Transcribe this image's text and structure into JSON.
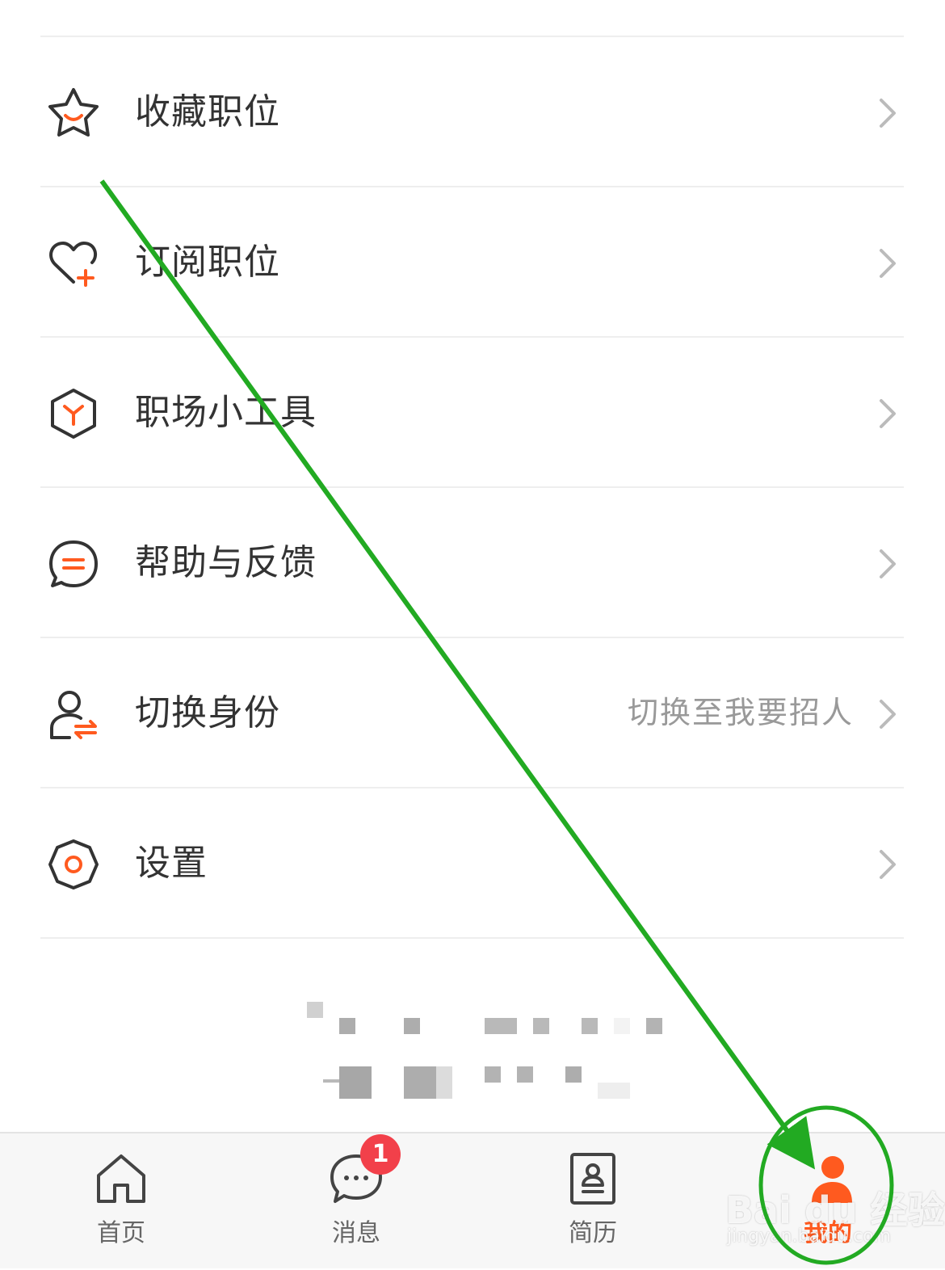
{
  "menu": {
    "items": [
      {
        "label": "收藏职位",
        "icon": "star-smile-icon"
      },
      {
        "label": "订阅职位",
        "icon": "heart-plus-icon"
      },
      {
        "label": "职场小工具",
        "icon": "hexagon-tool-icon"
      },
      {
        "label": "帮助与反馈",
        "icon": "chat-bubble-icon"
      },
      {
        "label": "切换身份",
        "icon": "user-switch-icon",
        "secondary": "切换至我要招人"
      },
      {
        "label": "设置",
        "icon": "gear-icon"
      }
    ]
  },
  "tabbar": {
    "tabs": [
      {
        "label": "首页",
        "icon": "home-icon"
      },
      {
        "label": "消息",
        "icon": "message-icon",
        "badge": "1"
      },
      {
        "label": "简历",
        "icon": "resume-icon"
      },
      {
        "label": "我的",
        "icon": "profile-icon",
        "active": true
      }
    ]
  },
  "watermark": {
    "text": "Bai du 经验",
    "sub": "jingyan.baidu.com"
  },
  "colors": {
    "accent": "#ff5a1f",
    "annotation": "#22aa22",
    "badge": "#f2404a"
  }
}
